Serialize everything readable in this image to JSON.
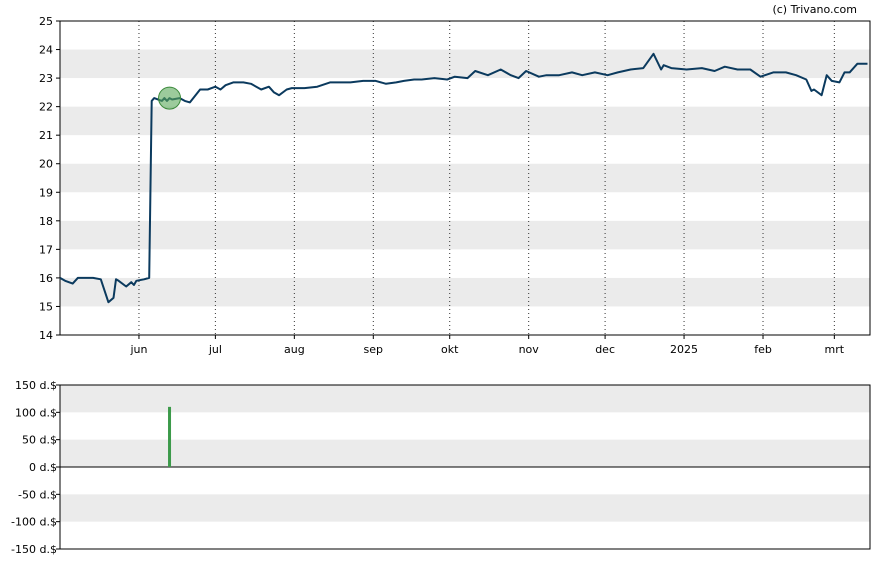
{
  "credit": "(c) Trivano.com",
  "chart_data": [
    {
      "type": "line",
      "title": "",
      "xlabel": "",
      "ylabel": "",
      "ylim": [
        14,
        25
      ],
      "y_ticks": [
        14,
        15,
        16,
        17,
        18,
        19,
        20,
        21,
        22,
        23,
        24,
        25
      ],
      "grid": "alternating horizontal bands, dotted vertical month lines",
      "line_color": "#0b3a5e",
      "band_color": "#ebebeb",
      "marker_color": "#5aa85a",
      "x_ticks": [
        {
          "label": "jun",
          "x": "2024-06-01"
        },
        {
          "label": "jul",
          "x": "2024-07-01"
        },
        {
          "label": "aug",
          "x": "2024-08-01"
        },
        {
          "label": "sep",
          "x": "2024-09-01"
        },
        {
          "label": "okt",
          "x": "2024-10-01"
        },
        {
          "label": "nov",
          "x": "2024-11-01"
        },
        {
          "label": "dec",
          "x": "2024-12-01"
        },
        {
          "label": "2025",
          "x": "2025-01-01"
        },
        {
          "label": "feb",
          "x": "2025-02-01"
        },
        {
          "label": "mrt",
          "x": "2025-03-01"
        }
      ],
      "xlim": [
        "2024-05-01",
        "2025-03-15"
      ],
      "marker": {
        "x": "2024-06-13",
        "y": 22.3
      },
      "series": [
        {
          "x": [
            "2024-05-01",
            "2024-05-03",
            "2024-05-06",
            "2024-05-08",
            "2024-05-10",
            "2024-05-14",
            "2024-05-17",
            "2024-05-20",
            "2024-05-22",
            "2024-05-23",
            "2024-05-24",
            "2024-05-27",
            "2024-05-29",
            "2024-05-30",
            "2024-05-31",
            "2024-06-03",
            "2024-06-05",
            "2024-06-06",
            "2024-06-07",
            "2024-06-10",
            "2024-06-11",
            "2024-06-12",
            "2024-06-13",
            "2024-06-14",
            "2024-06-17",
            "2024-06-19",
            "2024-06-21",
            "2024-06-25",
            "2024-06-28",
            "2024-07-01",
            "2024-07-03",
            "2024-07-05",
            "2024-07-08",
            "2024-07-12",
            "2024-07-15",
            "2024-07-19",
            "2024-07-22",
            "2024-07-24",
            "2024-07-26",
            "2024-07-29",
            "2024-07-31",
            "2024-08-05",
            "2024-08-10",
            "2024-08-15",
            "2024-08-19",
            "2024-08-23",
            "2024-08-28",
            "2024-09-02",
            "2024-09-06",
            "2024-09-10",
            "2024-09-13",
            "2024-09-17",
            "2024-09-20",
            "2024-09-25",
            "2024-09-30",
            "2024-10-03",
            "2024-10-08",
            "2024-10-11",
            "2024-10-16",
            "2024-10-21",
            "2024-10-25",
            "2024-10-28",
            "2024-10-31",
            "2024-11-05",
            "2024-11-08",
            "2024-11-13",
            "2024-11-18",
            "2024-11-22",
            "2024-11-27",
            "2024-12-02",
            "2024-12-06",
            "2024-12-11",
            "2024-12-16",
            "2024-12-20",
            "2024-12-23",
            "2024-12-24",
            "2024-12-27",
            "2025-01-02",
            "2025-01-08",
            "2025-01-13",
            "2025-01-17",
            "2025-01-22",
            "2025-01-27",
            "2025-01-31",
            "2025-02-05",
            "2025-02-10",
            "2025-02-14",
            "2025-02-18",
            "2025-02-20",
            "2025-02-21",
            "2025-02-24",
            "2025-02-26",
            "2025-02-28",
            "2025-03-03",
            "2025-03-05",
            "2025-03-07",
            "2025-03-10",
            "2025-03-12",
            "2025-03-14"
          ],
          "y": [
            16.0,
            15.9,
            15.8,
            16.0,
            16.0,
            16.0,
            15.95,
            15.15,
            15.3,
            15.95,
            15.9,
            15.7,
            15.85,
            15.75,
            15.9,
            15.95,
            16.0,
            22.2,
            22.3,
            22.2,
            22.3,
            22.2,
            22.3,
            22.25,
            22.3,
            22.2,
            22.15,
            22.6,
            22.6,
            22.7,
            22.6,
            22.75,
            22.85,
            22.85,
            22.8,
            22.6,
            22.7,
            22.5,
            22.4,
            22.6,
            22.65,
            22.65,
            22.7,
            22.85,
            22.85,
            22.85,
            22.9,
            22.9,
            22.8,
            22.85,
            22.9,
            22.95,
            22.95,
            23.0,
            22.95,
            23.05,
            23.0,
            23.25,
            23.1,
            23.3,
            23.1,
            23.0,
            23.25,
            23.05,
            23.1,
            23.1,
            23.2,
            23.1,
            23.2,
            23.1,
            23.2,
            23.3,
            23.35,
            23.85,
            23.3,
            23.45,
            23.35,
            23.3,
            23.35,
            23.25,
            23.4,
            23.3,
            23.3,
            23.05,
            23.2,
            23.2,
            23.1,
            22.95,
            22.55,
            22.6,
            22.4,
            23.1,
            22.9,
            22.85,
            23.2,
            23.2,
            23.5,
            23.5,
            23.5
          ]
        }
      ]
    },
    {
      "type": "bar",
      "title": "",
      "xlabel": "",
      "ylabel": "",
      "ylim": [
        -150,
        150
      ],
      "y_ticks": [
        {
          "value": 150,
          "label": "150 d.$"
        },
        {
          "value": 100,
          "label": "100 d.$"
        },
        {
          "value": 50,
          "label": "50 d.$"
        },
        {
          "value": 0,
          "label": "0 d.$"
        },
        {
          "value": -50,
          "label": "-50 d.$"
        },
        {
          "value": -100,
          "label": "-100 d.$"
        },
        {
          "value": -150,
          "label": "-150 d.$"
        }
      ],
      "xlim": [
        "2024-05-01",
        "2025-03-15"
      ],
      "bar_color": "#3c9a4a",
      "series": [
        {
          "x": [
            "2024-06-13"
          ],
          "values": [
            110
          ]
        }
      ]
    }
  ]
}
